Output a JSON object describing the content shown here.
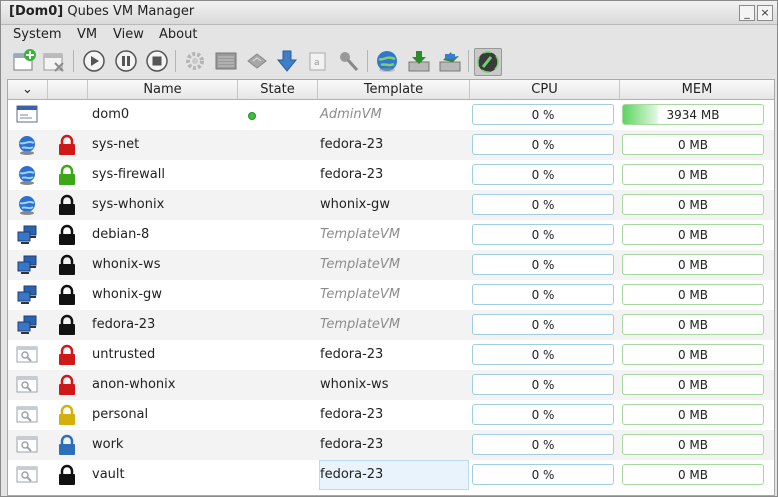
{
  "window": {
    "title_bold": "[Dom0]",
    "title_rest": " Qubes VM Manager"
  },
  "menu": [
    "System",
    "VM",
    "View",
    "About"
  ],
  "toolbar_icons": [
    "create-vm-icon",
    "remove-vm-icon",
    "start-vm-icon",
    "pause-vm-icon",
    "stop-vm-icon",
    "settings-icon",
    "run-command-icon",
    "attach-detach-icon",
    "update-vm-icon",
    "logs-icon",
    "firewall-icon",
    "global-settings-icon",
    "backup-icon",
    "restore-icon",
    "show-hide-inactive-icon"
  ],
  "columns": {
    "sort": "⌄",
    "name": "Name",
    "state": "State",
    "template": "Template",
    "cpu": "CPU",
    "mem": "MEM"
  },
  "colors": {
    "red": "#d01818",
    "green": "#3ca818",
    "gray": "#a9a9a9",
    "yellow": "#d4b00e",
    "blue": "#2f6eb8",
    "black": "#111111"
  },
  "vms": [
    {
      "name": "dom0",
      "icon": "dom0",
      "lock": null,
      "running": true,
      "template": "AdminVM",
      "template_italic": true,
      "cpu": "0 %",
      "mem": "3934 MB",
      "mem_fraction": 0.25
    },
    {
      "name": "sys-net",
      "icon": "netvm",
      "lock": "red",
      "running": false,
      "template": "fedora-23",
      "template_italic": false,
      "cpu": "0 %",
      "mem": "0 MB",
      "mem_fraction": 0
    },
    {
      "name": "sys-firewall",
      "icon": "netvm",
      "lock": "green",
      "running": false,
      "template": "fedora-23",
      "template_italic": false,
      "cpu": "0 %",
      "mem": "0 MB",
      "mem_fraction": 0
    },
    {
      "name": "sys-whonix",
      "icon": "netvm",
      "lock": "black",
      "running": false,
      "template": "whonix-gw",
      "template_italic": false,
      "cpu": "0 %",
      "mem": "0 MB",
      "mem_fraction": 0
    },
    {
      "name": "debian-8",
      "icon": "templatevm",
      "lock": "black",
      "running": false,
      "template": "TemplateVM",
      "template_italic": true,
      "cpu": "0 %",
      "mem": "0 MB",
      "mem_fraction": 0
    },
    {
      "name": "whonix-ws",
      "icon": "templatevm",
      "lock": "black",
      "running": false,
      "template": "TemplateVM",
      "template_italic": true,
      "cpu": "0 %",
      "mem": "0 MB",
      "mem_fraction": 0
    },
    {
      "name": "whonix-gw",
      "icon": "templatevm",
      "lock": "black",
      "running": false,
      "template": "TemplateVM",
      "template_italic": true,
      "cpu": "0 %",
      "mem": "0 MB",
      "mem_fraction": 0
    },
    {
      "name": "fedora-23",
      "icon": "templatevm",
      "lock": "black",
      "running": false,
      "template": "TemplateVM",
      "template_italic": true,
      "cpu": "0 %",
      "mem": "0 MB",
      "mem_fraction": 0
    },
    {
      "name": "untrusted",
      "icon": "appvm",
      "lock": "red",
      "running": false,
      "template": "fedora-23",
      "template_italic": false,
      "cpu": "0 %",
      "mem": "0 MB",
      "mem_fraction": 0
    },
    {
      "name": "anon-whonix",
      "icon": "appvm",
      "lock": "red",
      "running": false,
      "template": "whonix-ws",
      "template_italic": false,
      "cpu": "0 %",
      "mem": "0 MB",
      "mem_fraction": 0
    },
    {
      "name": "personal",
      "icon": "appvm",
      "lock": "yellow",
      "running": false,
      "template": "fedora-23",
      "template_italic": false,
      "cpu": "0 %",
      "mem": "0 MB",
      "mem_fraction": 0
    },
    {
      "name": "work",
      "icon": "appvm",
      "lock": "blue",
      "running": false,
      "template": "fedora-23",
      "template_italic": false,
      "cpu": "0 %",
      "mem": "0 MB",
      "mem_fraction": 0
    },
    {
      "name": "vault",
      "icon": "appvm",
      "lock": "black",
      "running": false,
      "template": "fedora-23",
      "template_italic": false,
      "cpu": "0 %",
      "mem": "0 MB",
      "mem_fraction": 0,
      "selected_cell": "template"
    }
  ]
}
